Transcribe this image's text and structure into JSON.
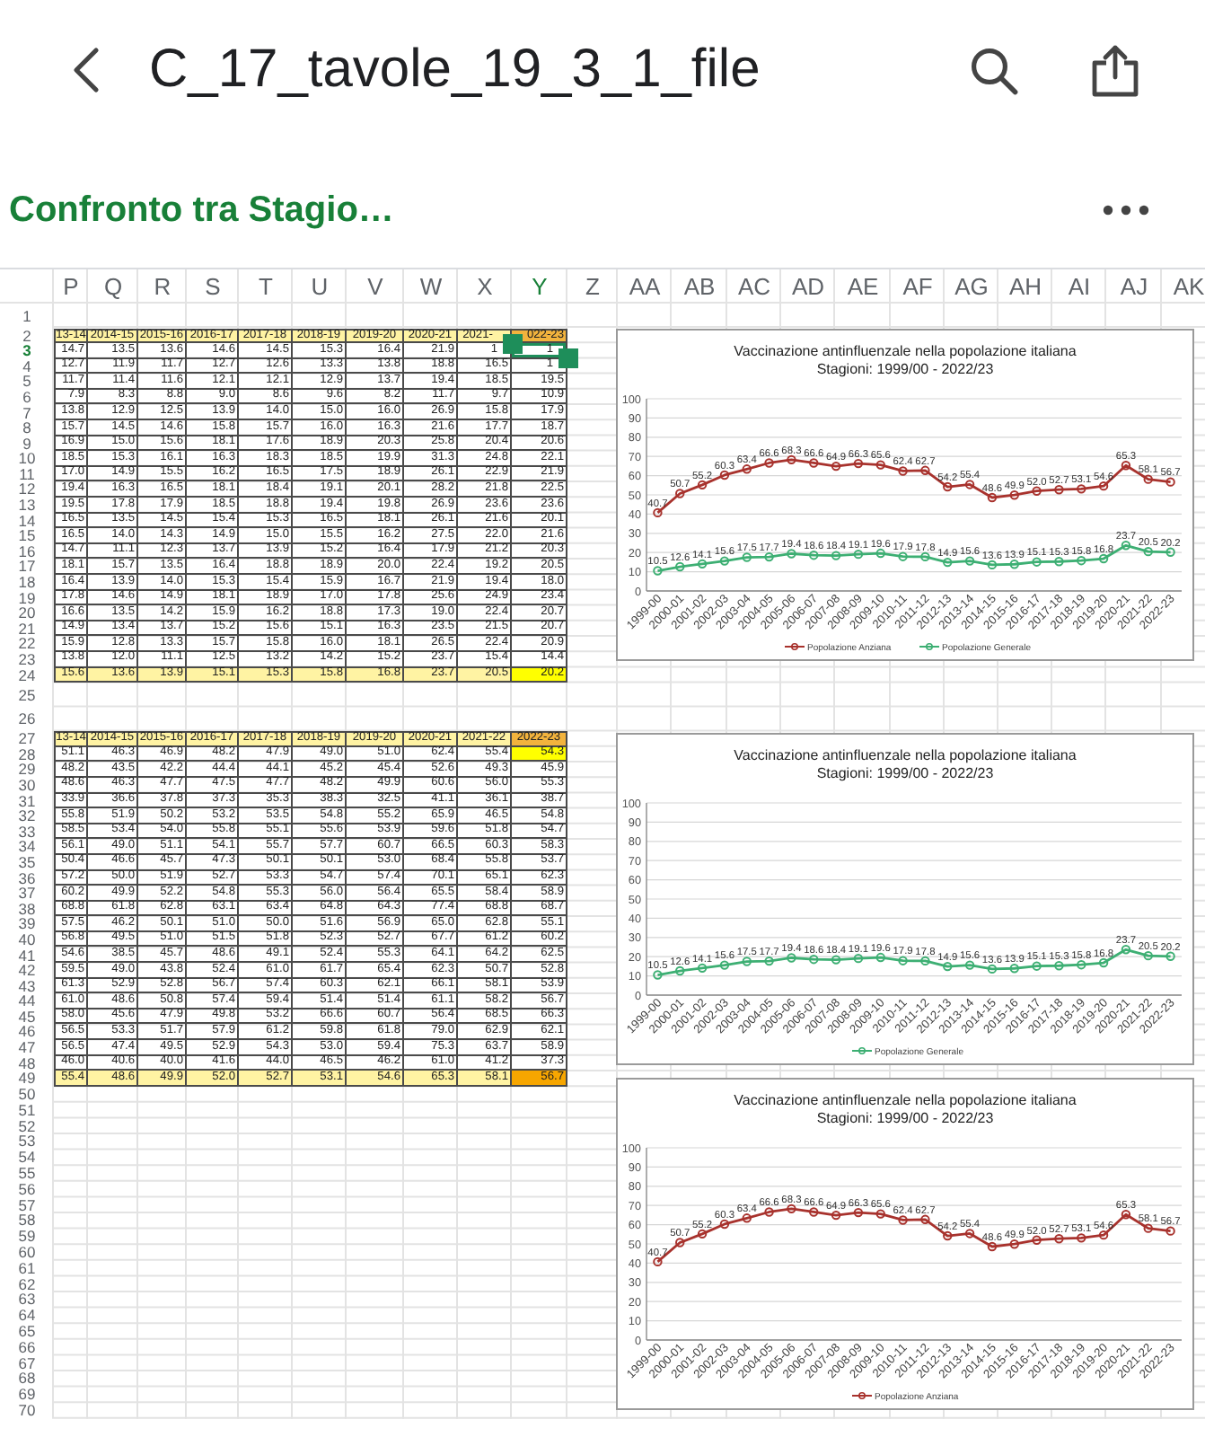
{
  "app_bar": {
    "title": "C_17_tavole_19_3_1_file"
  },
  "sheet_name": "Confronto tra Stagio…",
  "sheet": {
    "columns": [
      {
        "label": "P",
        "selected": false
      },
      {
        "label": "Q",
        "selected": false
      },
      {
        "label": "R",
        "selected": false
      },
      {
        "label": "S",
        "selected": false
      },
      {
        "label": "T",
        "selected": false
      },
      {
        "label": "U",
        "selected": false
      },
      {
        "label": "V",
        "selected": false
      },
      {
        "label": "W",
        "selected": false
      },
      {
        "label": "X",
        "selected": false
      },
      {
        "label": "Y",
        "selected": true
      },
      {
        "label": "Z",
        "selected": false
      },
      {
        "label": "AA",
        "selected": false
      },
      {
        "label": "AB",
        "selected": false
      },
      {
        "label": "AC",
        "selected": false
      },
      {
        "label": "AD",
        "selected": false
      },
      {
        "label": "AE",
        "selected": false
      },
      {
        "label": "AF",
        "selected": false
      },
      {
        "label": "AG",
        "selected": false
      },
      {
        "label": "AH",
        "selected": false
      },
      {
        "label": "AI",
        "selected": false
      },
      {
        "label": "AJ",
        "selected": false
      },
      {
        "label": "AK",
        "selected": false
      }
    ],
    "rows": [
      {
        "number": "1",
        "selected": false,
        "kind": "spacer"
      },
      {
        "number": "2",
        "selected": false,
        "kind": "header",
        "cells": [
          "13-14",
          "2014-15",
          "2015-16",
          "2016-17",
          "2017-18",
          "2018-19",
          "2019-20",
          "2020-21",
          "2021-",
          {
            "text": "022-23",
            "color": "#f2b33d"
          }
        ]
      },
      {
        "number": "3",
        "selected": true,
        "kind": "data",
        "cells": [
          "14.7",
          "13.5",
          "13.6",
          "14.6",
          "14.5",
          "15.3",
          "16.4",
          "21.9",
          "1",
          "1"
        ]
      },
      {
        "number": "4",
        "selected": false,
        "kind": "data",
        "cells": [
          "12.7",
          "11.9",
          "11.7",
          "12.7",
          "12.6",
          "13.3",
          "13.8",
          "18.8",
          "16.5",
          "1"
        ]
      },
      {
        "number": "5",
        "selected": false,
        "kind": "data",
        "cells": [
          "11.7",
          "11.4",
          "11.6",
          "12.1",
          "12.1",
          "12.9",
          "13.7",
          "19.4",
          "18.5",
          "19.5"
        ]
      },
      {
        "number": "6",
        "selected": false,
        "kind": "data",
        "cells": [
          "7.9",
          "8.3",
          "8.8",
          "9.0",
          "8.6",
          "9.6",
          "8.2",
          "11.7",
          "9.7",
          "10.9"
        ]
      },
      {
        "number": "7",
        "selected": false,
        "kind": "data",
        "cells": [
          "13.8",
          "12.9",
          "12.5",
          "13.9",
          "14.0",
          "15.0",
          "16.0",
          "26.9",
          "15.8",
          "17.9"
        ]
      },
      {
        "number": "8",
        "selected": false,
        "kind": "data",
        "cells": [
          "15.7",
          "14.5",
          "14.6",
          "15.8",
          "15.7",
          "16.0",
          "16.3",
          "21.6",
          "17.7",
          "18.7"
        ]
      },
      {
        "number": "9",
        "selected": false,
        "kind": "data",
        "cells": [
          "16.9",
          "15.0",
          "15.6",
          "18.1",
          "17.6",
          "18.9",
          "20.3",
          "25.8",
          "20.4",
          "20.6"
        ]
      },
      {
        "number": "10",
        "selected": false,
        "kind": "data",
        "cells": [
          "18.5",
          "15.3",
          "16.1",
          "16.3",
          "18.3",
          "18.5",
          "19.9",
          "31.3",
          "24.8",
          "22.1"
        ]
      },
      {
        "number": "11",
        "selected": false,
        "kind": "data",
        "cells": [
          "17.0",
          "14.9",
          "15.5",
          "16.2",
          "16.5",
          "17.5",
          "18.9",
          "26.1",
          "22.9",
          "21.9"
        ]
      },
      {
        "number": "12",
        "selected": false,
        "kind": "data",
        "cells": [
          "19.4",
          "16.3",
          "16.5",
          "18.1",
          "18.4",
          "19.1",
          "20.1",
          "28.2",
          "21.8",
          "22.5"
        ]
      },
      {
        "number": "13",
        "selected": false,
        "kind": "data",
        "cells": [
          "19.5",
          "17.8",
          "17.9",
          "18.5",
          "18.8",
          "19.4",
          "19.8",
          "26.9",
          "23.6",
          "23.6"
        ]
      },
      {
        "number": "14",
        "selected": false,
        "kind": "data",
        "cells": [
          "16.5",
          "13.5",
          "14.5",
          "15.4",
          "15.3",
          "16.5",
          "18.1",
          "26.1",
          "21.6",
          "20.1"
        ]
      },
      {
        "number": "15",
        "selected": false,
        "kind": "data",
        "cells": [
          "16.5",
          "14.0",
          "14.3",
          "14.9",
          "15.0",
          "15.5",
          "16.2",
          "27.5",
          "22.0",
          "21.6"
        ]
      },
      {
        "number": "16",
        "selected": false,
        "kind": "data",
        "cells": [
          "14.7",
          "11.1",
          "12.3",
          "13.7",
          "13.9",
          "15.2",
          "16.4",
          "17.9",
          "21.2",
          "20.3"
        ]
      },
      {
        "number": "17",
        "selected": false,
        "kind": "data",
        "cells": [
          "18.1",
          "15.7",
          "13.5",
          "16.4",
          "18.8",
          "18.9",
          "20.0",
          "22.4",
          "19.2",
          "20.5"
        ]
      },
      {
        "number": "18",
        "selected": false,
        "kind": "data",
        "cells": [
          "16.4",
          "13.9",
          "14.0",
          "15.3",
          "15.4",
          "15.9",
          "16.7",
          "21.9",
          "19.4",
          "18.0"
        ]
      },
      {
        "number": "19",
        "selected": false,
        "kind": "data",
        "cells": [
          "17.8",
          "14.6",
          "14.9",
          "18.1",
          "18.9",
          "17.0",
          "17.8",
          "25.6",
          "24.9",
          "23.4"
        ]
      },
      {
        "number": "20",
        "selected": false,
        "kind": "data",
        "cells": [
          "16.6",
          "13.5",
          "14.2",
          "15.9",
          "16.2",
          "18.8",
          "17.3",
          "19.0",
          "22.4",
          "20.7"
        ]
      },
      {
        "number": "21",
        "selected": false,
        "kind": "data",
        "cells": [
          "14.9",
          "13.4",
          "13.7",
          "15.2",
          "15.6",
          "15.1",
          "16.3",
          "23.5",
          "21.5",
          "20.7"
        ]
      },
      {
        "number": "22",
        "selected": false,
        "kind": "data",
        "cells": [
          "15.9",
          "12.8",
          "13.3",
          "15.7",
          "15.8",
          "16.0",
          "18.1",
          "26.5",
          "22.4",
          "20.9"
        ]
      },
      {
        "number": "23",
        "selected": false,
        "kind": "data",
        "cells": [
          "13.8",
          "12.0",
          "11.1",
          "12.5",
          "13.2",
          "14.2",
          "15.2",
          "23.7",
          "15.4",
          "14.4"
        ]
      },
      {
        "number": "24",
        "selected": false,
        "kind": "total",
        "cells": [
          "15.6",
          "13.6",
          "13.9",
          "15.1",
          "15.3",
          "15.8",
          "16.8",
          "23.7",
          "20.5",
          {
            "text": "20.2",
            "color": "#ffff00"
          }
        ]
      },
      {
        "number": "25",
        "selected": false,
        "kind": "spacer"
      },
      {
        "number": "26",
        "selected": false,
        "kind": "spacer"
      },
      {
        "number": "27",
        "selected": false,
        "kind": "header",
        "cells": [
          "13-14",
          "2014-15",
          "2015-16",
          "2016-17",
          "2017-18",
          "2018-19",
          "2019-20",
          "2020-21",
          "2021-22",
          {
            "text": "2022-23",
            "color": "#f2b33d"
          }
        ]
      },
      {
        "number": "28",
        "selected": false,
        "kind": "data",
        "cells": [
          "51.1",
          "46.3",
          "46.9",
          "48.2",
          "47.9",
          "49.0",
          "51.0",
          "62.4",
          "55.4",
          {
            "text": "54.3",
            "color": "#ffff00"
          }
        ]
      },
      {
        "number": "29",
        "selected": false,
        "kind": "data",
        "cells": [
          "48.2",
          "43.5",
          "42.2",
          "44.4",
          "44.1",
          "45.2",
          "45.4",
          "52.6",
          "49.3",
          "45.9"
        ]
      },
      {
        "number": "30",
        "selected": false,
        "kind": "data",
        "cells": [
          "48.6",
          "46.3",
          "47.7",
          "47.5",
          "47.7",
          "48.2",
          "49.9",
          "60.6",
          "56.0",
          "55.3"
        ]
      },
      {
        "number": "31",
        "selected": false,
        "kind": "data",
        "cells": [
          "33.9",
          "36.6",
          "37.8",
          "37.3",
          "35.3",
          "38.3",
          "32.5",
          "41.1",
          "36.1",
          "38.7"
        ]
      },
      {
        "number": "32",
        "selected": false,
        "kind": "data",
        "cells": [
          "55.8",
          "51.9",
          "50.2",
          "53.2",
          "53.5",
          "54.8",
          "55.2",
          "65.9",
          "46.5",
          "54.8"
        ]
      },
      {
        "number": "33",
        "selected": false,
        "kind": "data",
        "cells": [
          "58.5",
          "53.4",
          "54.0",
          "55.8",
          "55.1",
          "55.6",
          "53.9",
          "59.6",
          "51.8",
          "54.7"
        ]
      },
      {
        "number": "34",
        "selected": false,
        "kind": "data",
        "cells": [
          "56.1",
          "49.0",
          "51.1",
          "54.1",
          "55.7",
          "57.7",
          "60.7",
          "66.5",
          "60.3",
          "58.3"
        ]
      },
      {
        "number": "35",
        "selected": false,
        "kind": "data",
        "cells": [
          "50.4",
          "46.6",
          "45.7",
          "47.3",
          "50.1",
          "50.1",
          "53.0",
          "68.4",
          "55.8",
          "53.7"
        ]
      },
      {
        "number": "36",
        "selected": false,
        "kind": "data",
        "cells": [
          "57.2",
          "50.0",
          "51.9",
          "52.7",
          "53.3",
          "54.7",
          "57.4",
          "70.1",
          "65.1",
          "62.3"
        ]
      },
      {
        "number": "37",
        "selected": false,
        "kind": "data",
        "cells": [
          "60.2",
          "49.9",
          "52.2",
          "54.8",
          "55.3",
          "56.0",
          "56.4",
          "65.5",
          "58.4",
          "58.9"
        ]
      },
      {
        "number": "38",
        "selected": false,
        "kind": "data",
        "cells": [
          "68.8",
          "61.8",
          "62.8",
          "63.1",
          "63.4",
          "64.8",
          "64.3",
          "77.4",
          "68.8",
          "68.7"
        ]
      },
      {
        "number": "39",
        "selected": false,
        "kind": "data",
        "cells": [
          "57.5",
          "46.2",
          "50.1",
          "51.0",
          "50.0",
          "51.6",
          "56.9",
          "65.0",
          "62.8",
          "55.1"
        ]
      },
      {
        "number": "40",
        "selected": false,
        "kind": "data",
        "cells": [
          "56.8",
          "49.5",
          "51.0",
          "51.5",
          "51.8",
          "52.3",
          "52.7",
          "67.7",
          "61.2",
          "60.2"
        ]
      },
      {
        "number": "41",
        "selected": false,
        "kind": "data",
        "cells": [
          "54.6",
          "38.5",
          "45.7",
          "48.6",
          "49.1",
          "52.4",
          "55.3",
          "64.1",
          "64.2",
          "62.5"
        ]
      },
      {
        "number": "42",
        "selected": false,
        "kind": "data",
        "cells": [
          "59.5",
          "49.0",
          "43.8",
          "52.4",
          "61.0",
          "61.7",
          "65.4",
          "62.3",
          "50.7",
          "52.8"
        ]
      },
      {
        "number": "43",
        "selected": false,
        "kind": "data",
        "cells": [
          "61.3",
          "52.9",
          "52.8",
          "56.7",
          "57.4",
          "60.3",
          "62.1",
          "66.1",
          "58.1",
          "53.9"
        ]
      },
      {
        "number": "44",
        "selected": false,
        "kind": "data",
        "cells": [
          "61.0",
          "48.6",
          "50.8",
          "57.4",
          "59.4",
          "51.4",
          "51.4",
          "61.1",
          "58.2",
          "56.7"
        ]
      },
      {
        "number": "45",
        "selected": false,
        "kind": "data",
        "cells": [
          "58.0",
          "45.6",
          "47.9",
          "49.8",
          "53.2",
          "66.6",
          "60.7",
          "56.4",
          "68.5",
          "66.3"
        ]
      },
      {
        "number": "46",
        "selected": false,
        "kind": "data",
        "cells": [
          "56.5",
          "53.3",
          "51.7",
          "57.9",
          "61.2",
          "59.8",
          "61.8",
          "79.0",
          "62.9",
          "62.1"
        ]
      },
      {
        "number": "47",
        "selected": false,
        "kind": "data",
        "cells": [
          "56.5",
          "47.4",
          "49.5",
          "52.9",
          "54.3",
          "53.0",
          "59.4",
          "75.3",
          "63.7",
          "58.9"
        ]
      },
      {
        "number": "48",
        "selected": false,
        "kind": "data",
        "cells": [
          "46.0",
          "40.6",
          "40.0",
          "41.6",
          "44.0",
          "46.5",
          "46.2",
          "61.0",
          "41.2",
          "37.3"
        ]
      },
      {
        "number": "49",
        "selected": false,
        "kind": "total",
        "cells": [
          "55.4",
          "48.6",
          "49.9",
          "52.0",
          "52.7",
          "53.1",
          "54.6",
          "65.3",
          "58.1",
          {
            "text": "56.7",
            "color": "#f7a600"
          }
        ]
      },
      {
        "number": "50",
        "selected": false,
        "kind": "empty"
      },
      {
        "number": "51",
        "selected": false,
        "kind": "empty"
      },
      {
        "number": "52",
        "selected": false,
        "kind": "empty"
      },
      {
        "number": "53",
        "selected": false,
        "kind": "empty"
      },
      {
        "number": "54",
        "selected": false,
        "kind": "empty"
      },
      {
        "number": "55",
        "selected": false,
        "kind": "empty"
      },
      {
        "number": "56",
        "selected": false,
        "kind": "empty"
      },
      {
        "number": "57",
        "selected": false,
        "kind": "empty"
      },
      {
        "number": "58",
        "selected": false,
        "kind": "empty"
      },
      {
        "number": "59",
        "selected": false,
        "kind": "empty"
      },
      {
        "number": "60",
        "selected": false,
        "kind": "empty"
      },
      {
        "number": "61",
        "selected": false,
        "kind": "empty"
      },
      {
        "number": "62",
        "selected": false,
        "kind": "empty"
      },
      {
        "number": "63",
        "selected": false,
        "kind": "empty"
      },
      {
        "number": "64",
        "selected": false,
        "kind": "empty"
      },
      {
        "number": "65",
        "selected": false,
        "kind": "empty"
      },
      {
        "number": "66",
        "selected": false,
        "kind": "empty"
      },
      {
        "number": "67",
        "selected": false,
        "kind": "empty"
      },
      {
        "number": "68",
        "selected": false,
        "kind": "empty"
      },
      {
        "number": "69",
        "selected": false,
        "kind": "empty"
      },
      {
        "number": "70",
        "selected": false,
        "kind": "empty"
      }
    ]
  },
  "charts": [
    {
      "subtitle": "Stagioni: 1999/00 - 2022/23",
      "chart_data": {
        "type": "line",
        "title": "Vaccinazione antinfluenzale nella popolazione italiana",
        "categories": [
          "1999-00",
          "2000-01",
          "2001-02",
          "2002-03",
          "2003-04",
          "2004-05",
          "2005-06",
          "2006-07",
          "2007-08",
          "2008-09",
          "2009-10",
          "2010-11",
          "2011-12",
          "2012-13",
          "2013-14",
          "2014-15",
          "2015-16",
          "2016-17",
          "2017-18",
          "2018-19",
          "2019-20",
          "2020-21",
          "2021-22",
          "2022-23"
        ],
        "series": [
          {
            "name": "Popolazione Anziana",
            "color": "#a8322d",
            "marker": "o",
            "values": [
              40.7,
              50.7,
              55.2,
              60.3,
              63.4,
              66.6,
              68.3,
              66.6,
              64.9,
              66.3,
              65.6,
              62.4,
              62.7,
              54.2,
              55.4,
              48.6,
              49.9,
              52.0,
              52.7,
              53.1,
              54.6,
              65.3,
              58.1,
              56.7
            ],
            "value_labels": [
              "40.7",
              "50.7",
              "55.2",
              "60.3",
              "63.4",
              "66.6",
              "68.3",
              "66.6",
              "64.9",
              "66.3",
              "65.6",
              "62.4",
              "62.7",
              "54.2",
              "55.4",
              "48.6",
              "49.9",
              "52.0",
              "52.7",
              "53.1",
              "54.6",
              "65.3",
              "58.1",
              "56.7"
            ]
          },
          {
            "name": "Popolazione Generale",
            "color": "#3daf73",
            "marker": "o",
            "values": [
              10.5,
              12.6,
              14.1,
              15.6,
              17.5,
              17.7,
              19.4,
              18.6,
              18.4,
              19.1,
              19.6,
              17.9,
              17.8,
              14.9,
              15.6,
              13.6,
              13.9,
              15.1,
              15.3,
              15.8,
              16.8,
              23.7,
              20.5,
              20.2
            ],
            "value_labels": [
              "10.5",
              "12.6",
              "14.1",
              "15.6",
              "17.5",
              "17.7",
              "19.4",
              "18.6",
              "18.4",
              "19.1",
              "19.6",
              "17.9",
              "17.8",
              "14.9",
              "15.6",
              "13.6",
              "13.9",
              "15.1",
              "15.3",
              "15.8",
              "16.8",
              "23.7",
              "20.5",
              "20.2"
            ]
          }
        ],
        "ylim": [
          0,
          100
        ],
        "yticks": [
          0,
          10,
          20,
          30,
          40,
          50,
          60,
          70,
          80,
          90,
          100
        ],
        "data_labels": true,
        "grid": "horizontal",
        "legend": "bottom"
      }
    },
    {
      "subtitle": "Stagioni: 1999/00 - 2022/23",
      "chart_data": {
        "type": "line",
        "title": "Vaccinazione antinfluenzale nella popolazione italiana",
        "categories": [
          "1999-00",
          "2000-01",
          "2001-02",
          "2002-03",
          "2003-04",
          "2004-05",
          "2005-06",
          "2006-07",
          "2007-08",
          "2008-09",
          "2009-10",
          "2010-11",
          "2011-12",
          "2012-13",
          "2013-14",
          "2014-15",
          "2015-16",
          "2016-17",
          "2017-18",
          "2018-19",
          "2019-20",
          "2020-21",
          "2021-22",
          "2022-23"
        ],
        "series": [
          {
            "name": "Popolazione Generale",
            "color": "#3daf73",
            "marker": "o",
            "values": [
              10.5,
              12.6,
              14.1,
              15.6,
              17.5,
              17.7,
              19.4,
              18.6,
              18.4,
              19.1,
              19.6,
              17.9,
              17.8,
              14.9,
              15.6,
              13.6,
              13.9,
              15.1,
              15.3,
              15.8,
              16.8,
              23.7,
              20.5,
              20.2
            ],
            "value_labels": [
              "10.5",
              "12.6",
              "14.1",
              "15.6",
              "17.5",
              "17.7",
              "19.4",
              "18.6",
              "18.4",
              "19.1",
              "19.6",
              "17.9",
              "17.8",
              "14.9",
              "15.6",
              "13.6",
              "13.9",
              "15.1",
              "15.3",
              "15.8",
              "16.8",
              "23.7",
              "20.5",
              "20.2"
            ]
          }
        ],
        "ylim": [
          0,
          100
        ],
        "yticks": [
          0,
          10,
          20,
          30,
          40,
          50,
          60,
          70,
          80,
          90,
          100
        ],
        "data_labels": true,
        "grid": "horizontal",
        "legend": "bottom"
      }
    },
    {
      "subtitle": "Stagioni: 1999/00 - 2022/23",
      "chart_data": {
        "type": "line",
        "title": "Vaccinazione antinfluenzale nella popolazione italiana",
        "categories": [
          "1999-00",
          "2000-01",
          "2001-02",
          "2002-03",
          "2003-04",
          "2004-05",
          "2005-06",
          "2006-07",
          "2007-08",
          "2008-09",
          "2009-10",
          "2010-11",
          "2011-12",
          "2012-13",
          "2013-14",
          "2014-15",
          "2015-16",
          "2016-17",
          "2017-18",
          "2018-19",
          "2019-20",
          "2020-21",
          "2021-22",
          "2022-23"
        ],
        "series": [
          {
            "name": "Popolazione Anziana",
            "color": "#a8322d",
            "marker": "o",
            "values": [
              40.7,
              50.7,
              55.2,
              60.3,
              63.4,
              66.6,
              68.3,
              66.6,
              64.9,
              66.3,
              65.6,
              62.4,
              62.7,
              54.2,
              55.4,
              48.6,
              49.9,
              52.0,
              52.7,
              53.1,
              54.6,
              65.3,
              58.1,
              56.7
            ],
            "value_labels": [
              "40.7",
              "50.7",
              "55.2",
              "60.3",
              "63.4",
              "66.6",
              "68.3",
              "66.6",
              "64.9",
              "66.3",
              "65.6",
              "62.4",
              "62.7",
              "54.2",
              "55.4",
              "48.6",
              "49.9",
              "52.0",
              "52.7",
              "53.1",
              "54.6",
              "65.3",
              "58.1",
              "56.7"
            ]
          }
        ],
        "ylim": [
          0,
          100
        ],
        "yticks": [
          0,
          10,
          20,
          30,
          40,
          50,
          60,
          70,
          80,
          90,
          100
        ],
        "data_labels": true,
        "grid": "horizontal",
        "legend": "bottom"
      }
    }
  ]
}
